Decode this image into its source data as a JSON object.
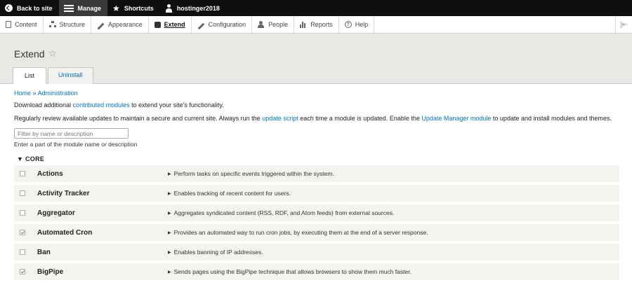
{
  "toolbar": {
    "back_to_site": "Back to site",
    "manage": "Manage",
    "shortcuts": "Shortcuts",
    "user": "hostinger2018"
  },
  "tray": {
    "items": [
      "Content",
      "Structure",
      "Appearance",
      "Extend",
      "Configuration",
      "People",
      "Reports",
      "Help"
    ],
    "active": "Extend"
  },
  "header": {
    "title": "Extend",
    "tabs": [
      "List",
      "Uninstall"
    ]
  },
  "breadcrumb": {
    "home": "Home",
    "sep": "»",
    "admin": "Administration"
  },
  "intro": {
    "p1_before": "Download additional ",
    "p1_link": "contributed modules",
    "p1_after": " to extend your site's functionality.",
    "p2_a": "Regularly review available updates to maintain a secure and current site. Always run the ",
    "p2_link1": "update script",
    "p2_b": " each time a module is updated. Enable the ",
    "p2_link2": "Update Manager module",
    "p2_c": " to update and install modules and themes."
  },
  "filter": {
    "placeholder": "Filter by name or description",
    "description": "Enter a part of the module name or description"
  },
  "core": {
    "label": "▼ CORE",
    "modules": [
      {
        "name": "Actions",
        "desc": "Perform tasks on specific events triggered within the system.",
        "checked": false
      },
      {
        "name": "Activity Tracker",
        "desc": "Enables tracking of recent content for users.",
        "checked": false
      },
      {
        "name": "Aggregator",
        "desc": "Aggregates syndicated content (RSS, RDF, and Atom feeds) from external sources.",
        "checked": false
      },
      {
        "name": "Automated Cron",
        "desc": "Provides an automated way to run cron jobs, by executing them at the end of a server response.",
        "checked": true
      },
      {
        "name": "Ban",
        "desc": "Enables banning of IP addresses.",
        "checked": false
      },
      {
        "name": "BigPipe",
        "desc": "Sends pages using the BigPipe technique that allows browsers to show them much faster.",
        "checked": true
      }
    ]
  }
}
